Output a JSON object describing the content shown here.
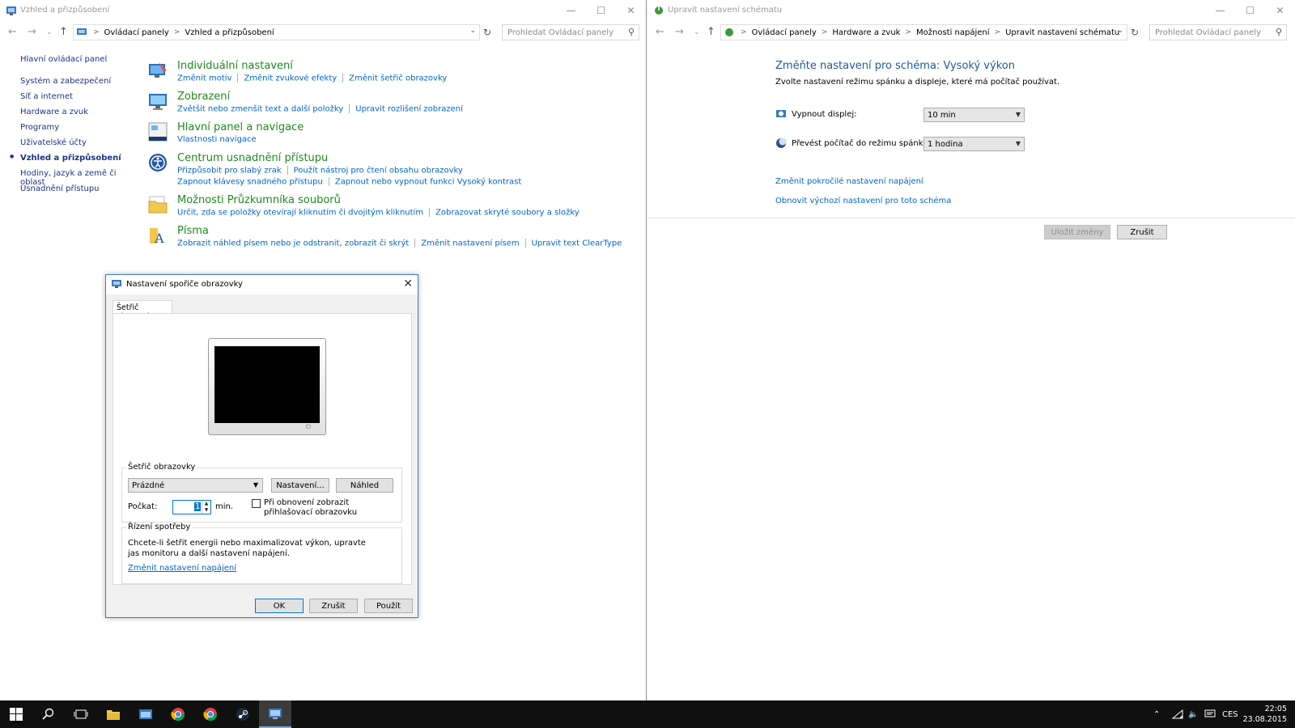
{
  "left_window": {
    "title": "Vzhled a přizpůsobení",
    "breadcrumb": [
      "Ovládací panely",
      "Vzhled a přizpůsobení"
    ],
    "search_placeholder": "Prohledat Ovládací panely",
    "sidenav": [
      "Hlavní ovládací panel",
      "Systém a zabezpečení",
      "Síť a internet",
      "Hardware a zvuk",
      "Programy",
      "Uživatelské účty",
      "Vzhled a přizpůsobení",
      "Hodiny, jazyk a země či oblast",
      "Usnadnění přístupu"
    ],
    "sidenav_current": "Vzhled a přizpůsobení",
    "categories": {
      "personalize": {
        "title": "Individuální nastavení",
        "links": [
          "Změnit motiv",
          "Změnit zvukové efekty",
          "Změnit šetřič obrazovky"
        ]
      },
      "display": {
        "title": "Zobrazení",
        "links": [
          "Zvětšit nebo zmenšit text a další položky",
          "Upravit rozlišení zobrazení"
        ]
      },
      "taskbar": {
        "title": "Hlavní panel a navigace",
        "links": [
          "Vlastnosti navigace"
        ]
      },
      "ease": {
        "title": "Centrum usnadnění přístupu",
        "links": [
          "Přizpůsobit pro slabý zrak",
          "Použít nástroj pro čtení obsahu obrazovky",
          "Zapnout klávesy snadného přístupu",
          "Zapnout nebo vypnout funkci Vysoký kontrast"
        ]
      },
      "explorer": {
        "title": "Možnosti Průzkumníka souborů",
        "links": [
          "Určit, zda se položky otevírají kliknutím či dvojitým kliknutím",
          "Zobrazovat skryté soubory a složky"
        ]
      },
      "fonts": {
        "title": "Písma",
        "links": [
          "Zobrazit náhled písem nebo je odstranit, zobrazit či skrýt",
          "Změnit nastavení písem",
          "Upravit text ClearType"
        ]
      }
    }
  },
  "right_window": {
    "title": "Upravit nastavení schématu",
    "breadcrumb": [
      "Ovládací panely",
      "Hardware a zvuk",
      "Možnosti napájení",
      "Upravit nastavení schématu"
    ],
    "search_placeholder": "Prohledat Ovládací panely",
    "heading": "Změňte nastavení pro schéma: Vysoký výkon",
    "subheading": "Zvolte nastavení režimu spánku a displeje, které má počítač používat.",
    "display_off_label": "Vypnout displej:",
    "display_off_value": "10 min",
    "sleep_label": "Převést počítač do režimu spánku:",
    "sleep_value": "1 hodina",
    "advanced_link": "Změnit pokročilé nastavení napájení",
    "restore_link": "Obnovit výchozí nastavení pro toto schéma",
    "save_label": "Uložit změny",
    "cancel_label": "Zrušit"
  },
  "dialog": {
    "title": "Nastavení spořiče obrazovky",
    "tab": "Šetřič obrazovky",
    "group_saver": "Šetřič obrazovky",
    "saver_value": "Prázdné",
    "settings_btn": "Nastavení...",
    "preview_btn": "Náhled",
    "wait_label": "Počkat:",
    "wait_value": "1",
    "wait_unit": "min.",
    "resume_label": "Při obnovení zobrazit přihlašovací obrazovku",
    "resume_checked": false,
    "group_power": "Řízení spotřeby",
    "power_text": "Chcete-li šetřit energii nebo maximalizovat výkon, upravte jas monitoru a další nastavení napájení.",
    "power_link": "Změnit nastavení napájení",
    "ok": "OK",
    "cancel": "Zrušit",
    "apply": "Použít"
  },
  "taskbar": {
    "lang": "CES",
    "time": "22:05",
    "date": "23.08.2015"
  },
  "colors": {
    "link": "#0066cc",
    "category_title": "#1e8a1e",
    "nav_text": "#1e3287",
    "heading_blue": "#1e5aa0",
    "taskbar": "#101010"
  }
}
